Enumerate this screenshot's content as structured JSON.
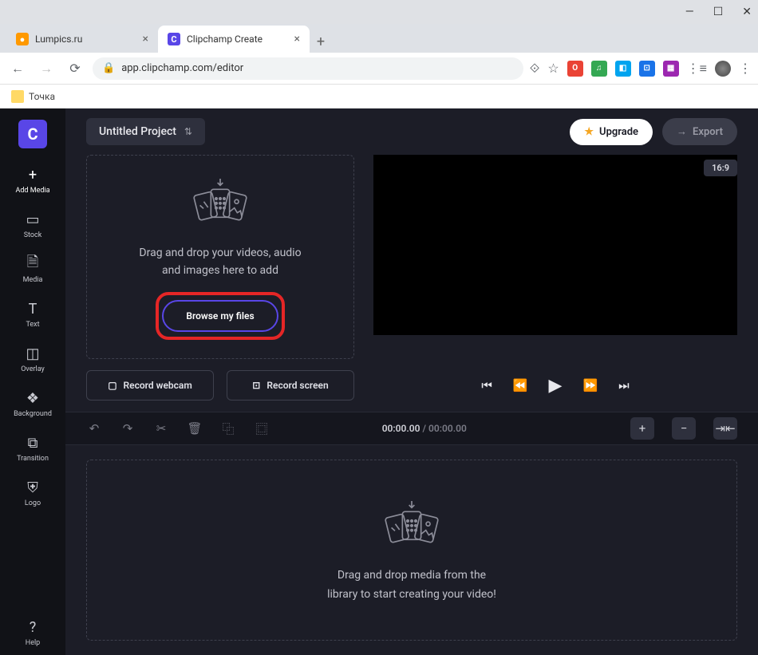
{
  "browser": {
    "tabs": [
      {
        "title": "Lumpics.ru",
        "active": false
      },
      {
        "title": "Clipchamp Create",
        "active": true
      }
    ],
    "url": "app.clipchamp.com/editor",
    "bookmark": "Точка"
  },
  "app": {
    "logo": "C",
    "sidebar": {
      "items": [
        {
          "icon": "plus",
          "label": "Add Media"
        },
        {
          "icon": "stock",
          "label": "Stock"
        },
        {
          "icon": "file",
          "label": "Media"
        },
        {
          "icon": "text",
          "label": "Text"
        },
        {
          "icon": "overlay",
          "label": "Overlay"
        },
        {
          "icon": "layers",
          "label": "Background"
        },
        {
          "icon": "transition",
          "label": "Transition"
        },
        {
          "icon": "shield",
          "label": "Logo"
        }
      ],
      "help": {
        "label": "Help"
      }
    },
    "topbar": {
      "project_title": "Untitled Project",
      "upgrade": "Upgrade",
      "export": "Export"
    },
    "dropzone": {
      "text_line1": "Drag and drop your videos, audio",
      "text_line2": "and images here to add",
      "browse": "Browse my files"
    },
    "record": {
      "webcam": "Record webcam",
      "screen": "Record screen"
    },
    "preview": {
      "aspect": "16:9"
    },
    "timeline_tools": {
      "time_current": "00:00.00",
      "time_total": "00:00.00"
    },
    "timeline": {
      "text_line1": "Drag and drop media from the",
      "text_line2": "library to start creating your video!"
    }
  }
}
